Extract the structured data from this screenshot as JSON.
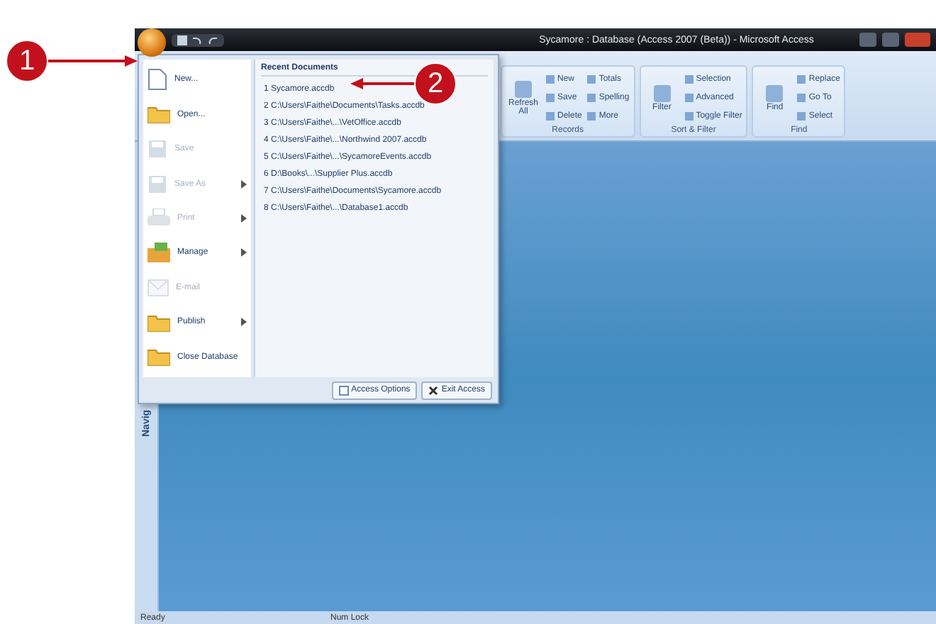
{
  "window": {
    "title": "Sycamore : Database (Access 2007 (Beta)) - Microsoft Access"
  },
  "ribbon": {
    "groups": [
      {
        "label": "Records",
        "buttons": [
          {
            "label": "Refresh All",
            "kind": "large"
          },
          {
            "label": "New",
            "kind": "small"
          },
          {
            "label": "Save",
            "kind": "small"
          },
          {
            "label": "Delete",
            "kind": "small"
          },
          {
            "label": "Totals",
            "kind": "small"
          },
          {
            "label": "Spelling",
            "kind": "small"
          },
          {
            "label": "More",
            "kind": "small"
          }
        ]
      },
      {
        "label": "Sort & Filter",
        "buttons": [
          {
            "label": "Filter",
            "kind": "large"
          },
          {
            "label": "Selection",
            "kind": "small"
          },
          {
            "label": "Advanced",
            "kind": "small"
          },
          {
            "label": "Toggle Filter",
            "kind": "small"
          }
        ]
      },
      {
        "label": "Find",
        "buttons": [
          {
            "label": "Find",
            "kind": "large"
          },
          {
            "label": "Replace",
            "kind": "small"
          },
          {
            "label": "Go To",
            "kind": "small"
          },
          {
            "label": "Select",
            "kind": "small"
          }
        ]
      }
    ]
  },
  "office_menu": {
    "items": [
      {
        "label": "New...",
        "disabled": false,
        "has_submenu": false
      },
      {
        "label": "Open...",
        "disabled": false,
        "has_submenu": false
      },
      {
        "label": "Save",
        "disabled": true,
        "has_submenu": false
      },
      {
        "label": "Save As",
        "disabled": true,
        "has_submenu": true
      },
      {
        "label": "Print",
        "disabled": true,
        "has_submenu": true
      },
      {
        "label": "Manage",
        "disabled": false,
        "has_submenu": true
      },
      {
        "label": "E-mail",
        "disabled": true,
        "has_submenu": false
      },
      {
        "label": "Publish",
        "disabled": false,
        "has_submenu": true
      },
      {
        "label": "Close Database",
        "disabled": false,
        "has_submenu": false
      }
    ],
    "recent_title": "Recent Documents",
    "recent": [
      "1 Sycamore.accdb",
      "2 C:\\Users\\Faithe\\Documents\\Tasks.accdb",
      "3 C:\\Users\\Faithe\\...\\VetOffice.accdb",
      "4 C:\\Users\\Faithe\\...\\Northwind 2007.accdb",
      "5 C:\\Users\\Faithe\\...\\SycamoreEvents.accdb",
      "6 D:\\Books\\...\\Supplier Plus.accdb",
      "7 C:\\Users\\Faithe\\Documents\\Sycamore.accdb",
      "8 C:\\Users\\Faithe\\...\\Database1.accdb"
    ],
    "buttons": [
      "Access Options",
      "Exit Access"
    ]
  },
  "nav_pane": {
    "label": "Navig"
  },
  "status_bar": [
    "Ready",
    "Num Lock"
  ],
  "callouts": [
    "1",
    "2"
  ]
}
